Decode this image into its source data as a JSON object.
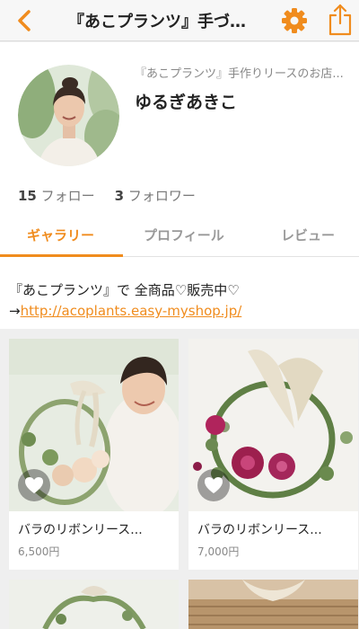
{
  "nav": {
    "title": "『あこプランツ』手づ…",
    "back_icon": "chevron-left-icon",
    "settings_icon": "gear-icon",
    "share_icon": "share-icon",
    "accent_color": "#f08c1e"
  },
  "profile": {
    "shop_label": "『あこプランツ』手作りリースのお店...",
    "user_name": "ゆるぎあきこ",
    "follow_count": "15",
    "follow_label": "フォロー",
    "follower_count": "3",
    "follower_label": "フォロワー"
  },
  "tabs": [
    {
      "label": "ギャラリー",
      "active": true
    },
    {
      "label": "プロフィール",
      "active": false
    },
    {
      "label": "レビュー",
      "active": false
    }
  ],
  "banner": {
    "line1": "『あこプランツ』で 全商品♡販売中♡",
    "arrow": "→",
    "link": "http://acoplants.easy-myshop.jp/"
  },
  "items": [
    {
      "name": "バラのリボンリース...",
      "price": "6,500円",
      "favorite_icon": "heart-icon"
    },
    {
      "name": "バラのリボンリース...",
      "price": "7,000円",
      "favorite_icon": "heart-icon"
    },
    {
      "name": "",
      "price": ""
    },
    {
      "name": "",
      "price": ""
    }
  ]
}
